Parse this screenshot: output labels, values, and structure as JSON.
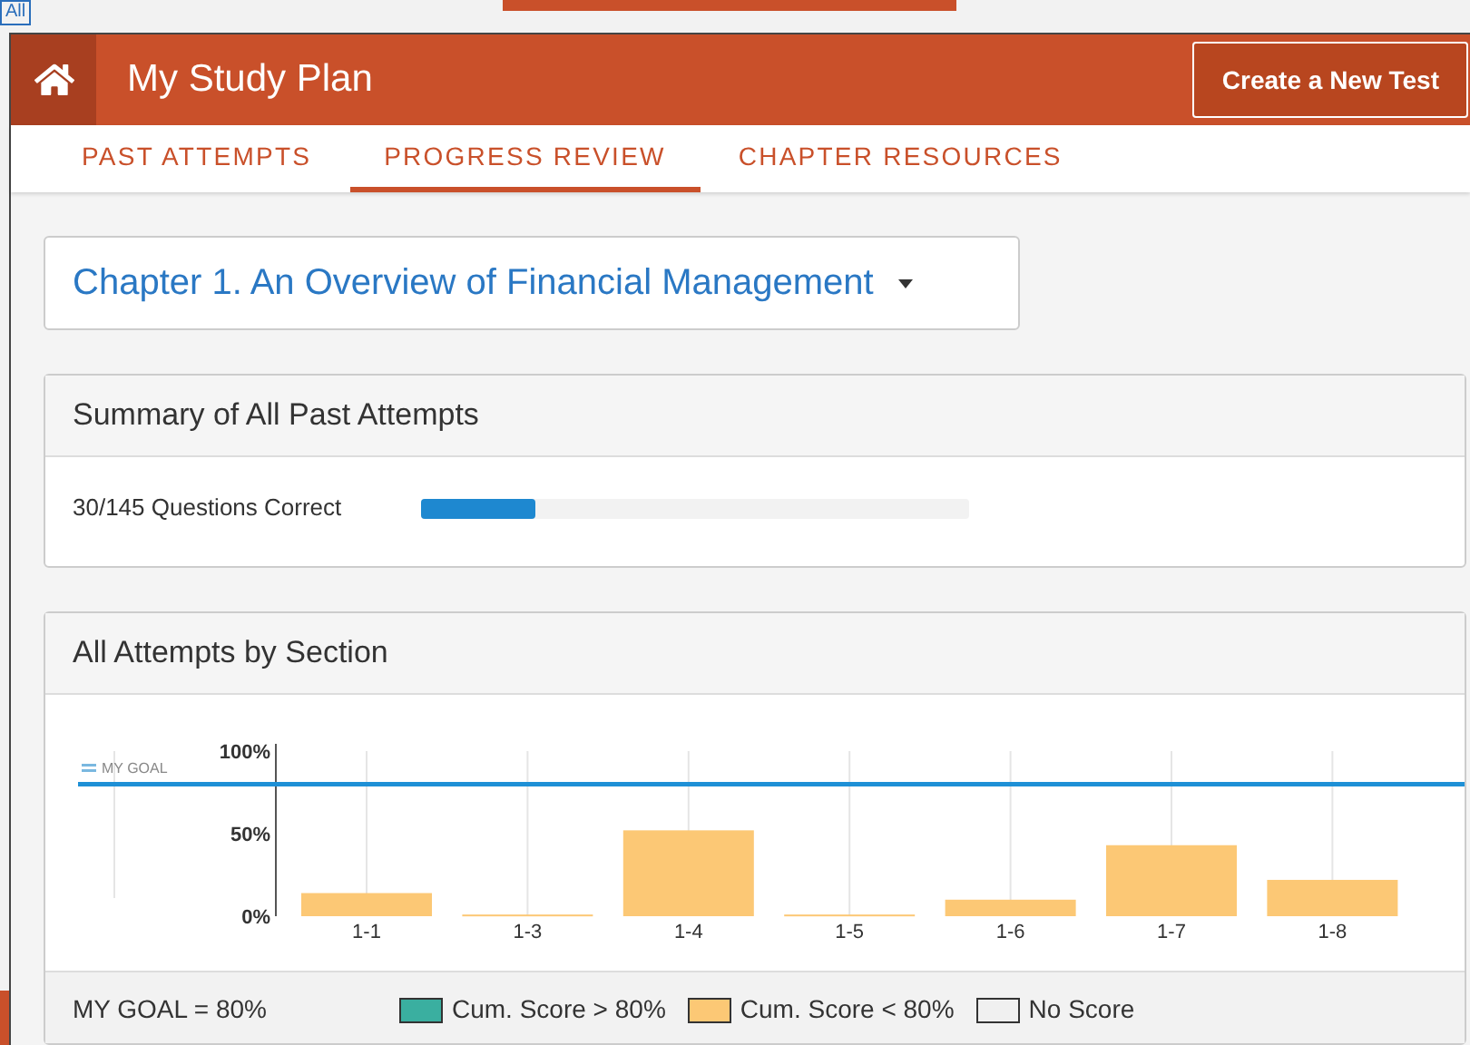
{
  "backdrop": {
    "link": "All"
  },
  "header": {
    "title": "My Study Plan",
    "button": "Create a New Test"
  },
  "tabs": [
    {
      "label": "PAST ATTEMPTS",
      "selected": false
    },
    {
      "label": "PROGRESS REVIEW",
      "selected": true
    },
    {
      "label": "CHAPTER RESOURCES",
      "selected": false
    }
  ],
  "chapter_select": {
    "value": "Chapter 1. An Overview of Financial Management"
  },
  "summary": {
    "title": "Summary of All Past Attempts",
    "label": "30/145 Questions Correct",
    "level": 0.207
  },
  "sections": {
    "title": "All Attempts by Section",
    "chart_data": {
      "type": "bar",
      "categories": [
        "1-1",
        "1-3",
        "1-4",
        "1-5",
        "1-6",
        "1-7",
        "1-8"
      ],
      "series": [
        {
          "color": "#fcc875",
          "values": [
            14,
            1,
            52,
            1,
            10,
            43,
            22
          ]
        }
      ],
      "grid": true,
      "ylim": [
        0,
        100
      ],
      "yticks": [
        {
          "value": 0,
          "label": "0%"
        },
        {
          "value": 50,
          "label": "50%"
        },
        {
          "value": 100,
          "label": "100%"
        }
      ],
      "ref_lines": [
        {
          "axis": "y",
          "value": 80,
          "label": "MY GOAL"
        }
      ]
    },
    "goal_text": "MY GOAL = 80%",
    "legend": [
      {
        "label": "Cum. Score > 80%",
        "color": "#3aafa0"
      },
      {
        "label": "Cum. Score < 80%",
        "color": "#fcc875"
      },
      {
        "label": "No Score",
        "color": "#f0f0f0"
      }
    ]
  }
}
